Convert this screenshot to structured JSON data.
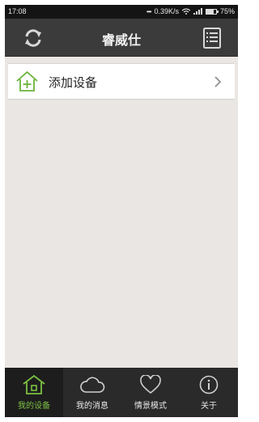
{
  "status": {
    "time": "17:08",
    "dots": "•••",
    "speed": "0.39K/s",
    "battery": "75%",
    "battery_level": 0.75
  },
  "header": {
    "title": "睿威仕",
    "refresh_icon": "refresh-icon",
    "menu_icon": "list-menu-icon"
  },
  "device_list": {
    "add_device_label": "添加设备",
    "add_icon": "home-plus-icon",
    "chevron_icon": "chevron-right-icon"
  },
  "tabs": [
    {
      "label": "我的设备",
      "icon": "home-icon",
      "active": true
    },
    {
      "label": "我的消息",
      "icon": "cloud-icon",
      "active": false
    },
    {
      "label": "情景模式",
      "icon": "heart-icon",
      "active": false
    },
    {
      "label": "关于",
      "icon": "info-icon",
      "active": false
    }
  ],
  "colors": {
    "accent": "#7cc043",
    "header_bg": "#3b3b3b",
    "tabbar_bg": "#2a2a2a",
    "content_bg": "#e9e6e3"
  }
}
